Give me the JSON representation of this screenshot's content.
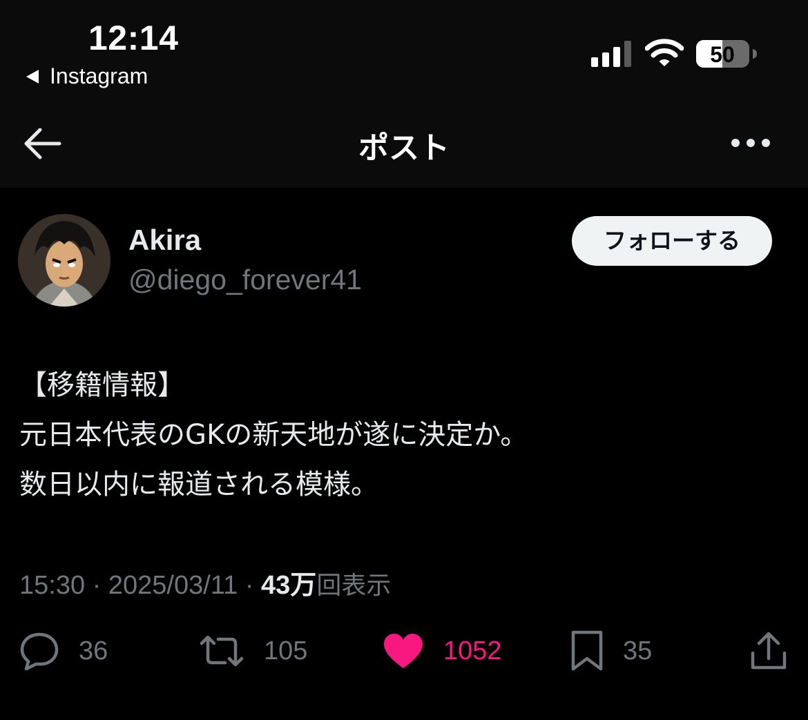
{
  "status_bar": {
    "time": "12:14",
    "back_app_label": "Instagram",
    "battery_level": "50"
  },
  "nav": {
    "title": "ポスト"
  },
  "author": {
    "display_name": "Akira",
    "handle": "@diego_forever41",
    "follow_label": "フォローする"
  },
  "post": {
    "lines": [
      "【移籍情報】",
      "元日本代表のGKの新天地が遂に決定か。",
      "数日以内に報道される模様。"
    ],
    "time": "15:30",
    "separator": " · ",
    "date": "2025/03/11",
    "views_count": "43万",
    "views_label": "回表示"
  },
  "actions": {
    "replies": "36",
    "reposts": "105",
    "likes": "1052",
    "bookmarks": "35"
  },
  "colors": {
    "background": "#000000",
    "header_bg": "#0b0b0b",
    "text_primary": "#e7e9ea",
    "text_secondary": "#71767b",
    "like_pink": "#f91880",
    "follow_button_bg": "#eff3f4"
  },
  "icons": [
    "signal-icon",
    "wifi-icon",
    "battery-icon",
    "back-arrow-icon",
    "more-icon",
    "reply-icon",
    "repost-icon",
    "like-icon",
    "bookmark-icon",
    "share-icon"
  ]
}
